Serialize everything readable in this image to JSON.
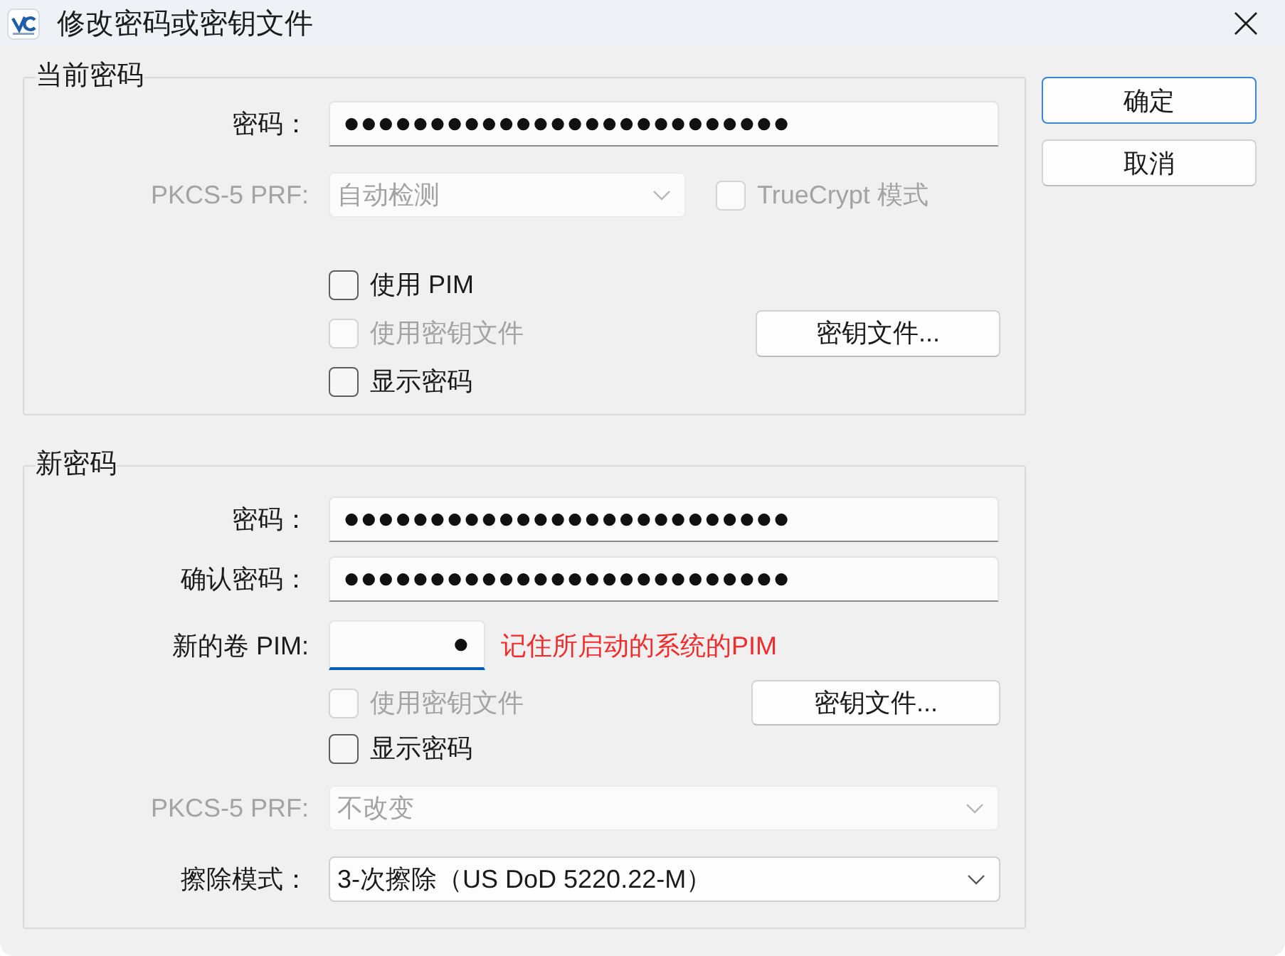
{
  "window": {
    "title": "修改密码或密钥文件"
  },
  "current_password": {
    "title": "当前密码",
    "password": {
      "label": "密码：",
      "value": "●●●●●●●●●●●●●●●●●●●●●●●●●●"
    },
    "prf": {
      "label": "PKCS-5 PRF:",
      "value": "自动检测",
      "disabled": true
    },
    "truecrypt_mode": {
      "label": "TrueCrypt 模式",
      "checked": false,
      "disabled": true
    },
    "options": [
      {
        "label": "使用 PIM",
        "checked": false,
        "disabled": false
      },
      {
        "label": "使用密钥文件",
        "checked": false,
        "disabled": true
      },
      {
        "label": "显示密码",
        "checked": false,
        "disabled": false
      }
    ],
    "keyfiles_button": "密钥文件..."
  },
  "buttons": [
    {
      "label": "确定",
      "default": true
    },
    {
      "label": "取消",
      "default": false
    }
  ],
  "new_password": {
    "title": "新密码",
    "password": {
      "label": "密码：",
      "value": "●●●●●●●●●●●●●●●●●●●●●●●●●●"
    },
    "confirm": {
      "label": "确认密码：",
      "value": "●●●●●●●●●●●●●●●●●●●●●●●●●●"
    },
    "pim": {
      "label": "新的卷 PIM:",
      "value": "●",
      "focused": true,
      "hint": "记住所启动的系统的PIM"
    },
    "options": [
      {
        "label": "使用密钥文件",
        "checked": false,
        "disabled": true
      },
      {
        "label": "显示密码",
        "checked": false,
        "disabled": false
      }
    ],
    "keyfiles_button": "密钥文件...",
    "prf": {
      "label": "PKCS-5 PRF:",
      "value": "不改变",
      "disabled": true
    },
    "wipe_mode": {
      "label": "擦除模式：",
      "value": "3-次擦除（US DoD 5220.22-M）",
      "disabled": false
    }
  }
}
